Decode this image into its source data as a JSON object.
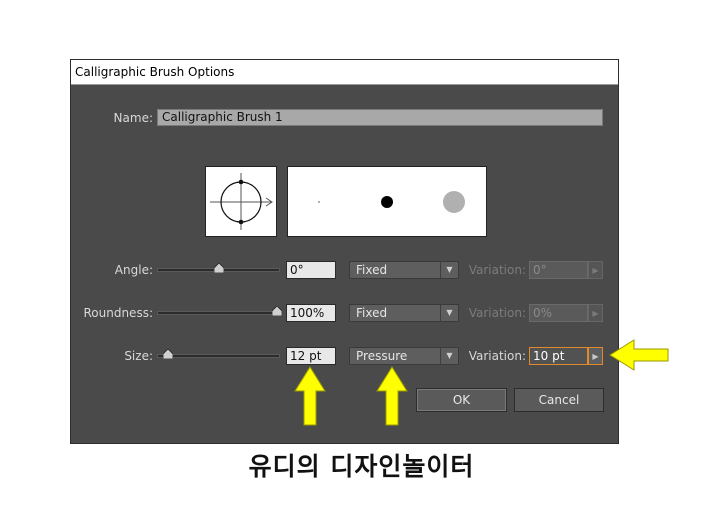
{
  "dialog": {
    "title": "Calligraphic Brush Options",
    "name_label": "Name:",
    "name_value": "Calligraphic Brush 1",
    "angle": {
      "label": "Angle:",
      "value": "0°",
      "mode": "Fixed",
      "variation_label": "Variation:",
      "variation_value": "0°",
      "slider_level": 0.5
    },
    "roundness": {
      "label": "Roundness:",
      "value": "100%",
      "mode": "Fixed",
      "variation_label": "Variation:",
      "variation_value": "0%",
      "slider_level": 1.0
    },
    "size": {
      "label": "Size:",
      "value": "12 pt",
      "mode": "Pressure",
      "variation_label": "Variation:",
      "variation_value": "10 pt",
      "slider_level": 0.1
    },
    "ok_label": "OK",
    "cancel_label": "Cancel"
  },
  "caption": "유디의 디자인놀이터",
  "colors": {
    "dialog_bg": "#4a4a4a",
    "highlight_arrow": "#ffff00",
    "active_border": "#e08a2a"
  },
  "icons": {
    "dropdown": "triangle-down-icon",
    "stepper": "triangle-right-icon",
    "annotation": "yellow-arrow-icon"
  }
}
